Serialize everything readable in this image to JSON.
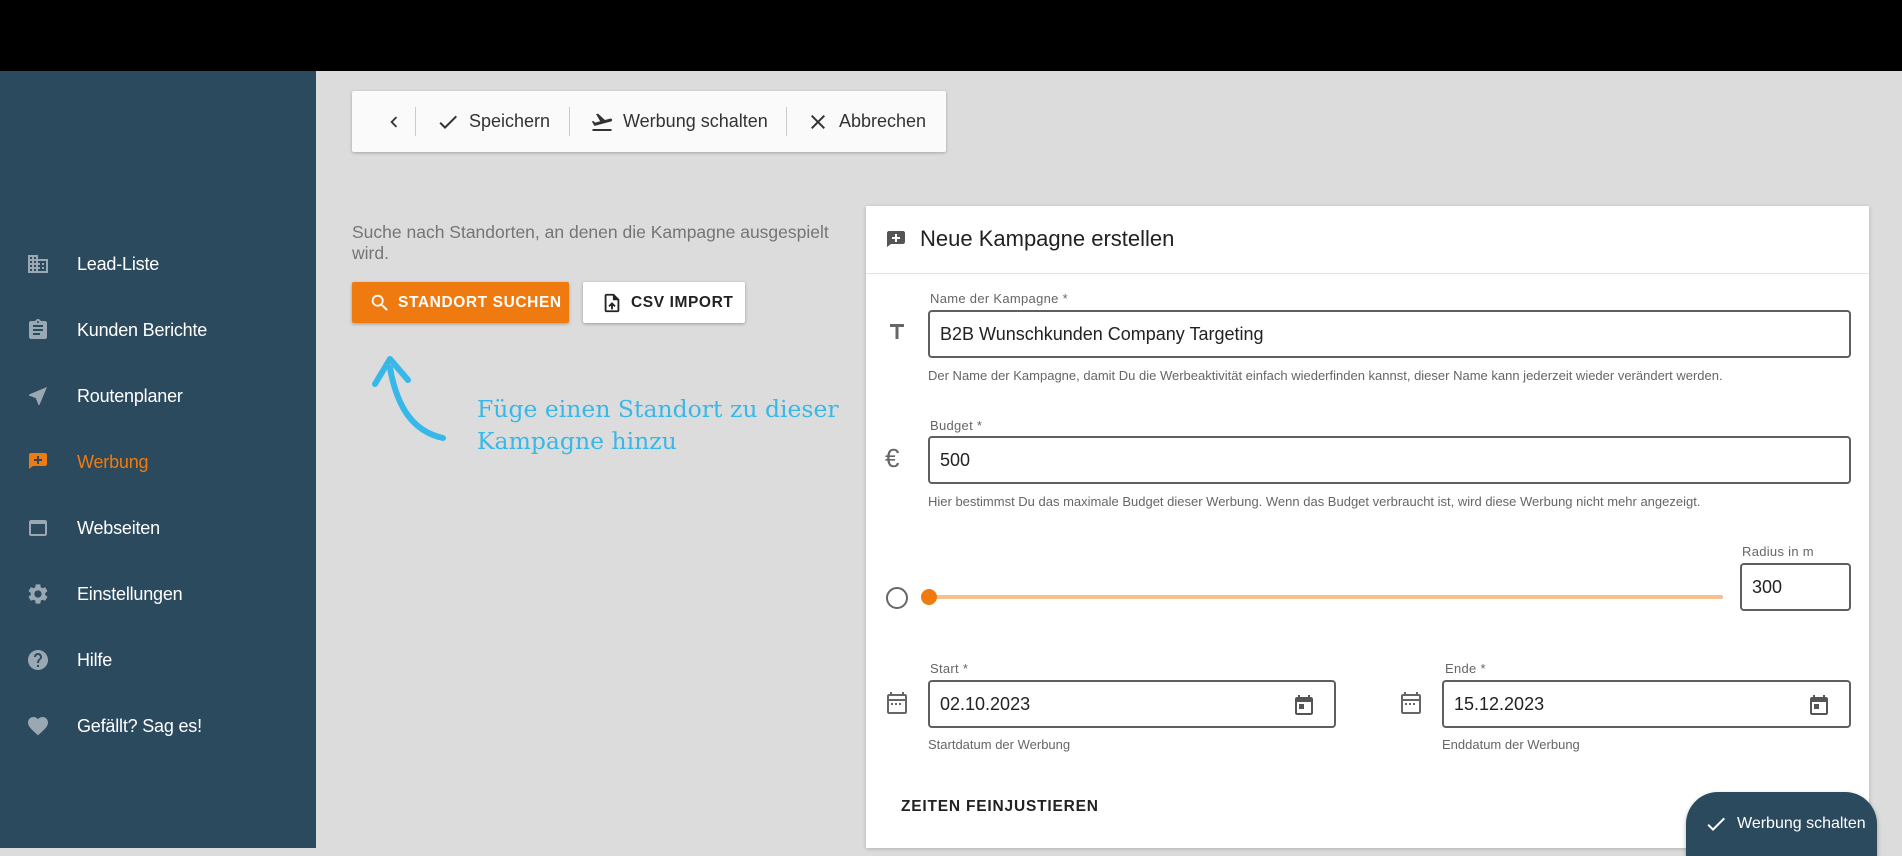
{
  "sidebar": {
    "items": [
      {
        "label": "Lead-Liste",
        "icon": "building-icon",
        "active": false
      },
      {
        "label": "Kunden Berichte",
        "icon": "clipboard-icon",
        "active": false
      },
      {
        "label": "Routenplaner",
        "icon": "navigation-icon",
        "active": false
      },
      {
        "label": "Werbung",
        "icon": "ad-icon",
        "active": true
      },
      {
        "label": "Webseiten",
        "icon": "browser-window-icon",
        "active": false
      },
      {
        "label": "Einstellungen",
        "icon": "gear-icon",
        "active": false
      },
      {
        "label": "Hilfe",
        "icon": "help-icon",
        "active": false
      },
      {
        "label": "Gefällt? Sag es!",
        "icon": "heart-icon",
        "active": false
      }
    ]
  },
  "toolbar": {
    "save_label": "Speichern",
    "publish_label": "Werbung schalten",
    "cancel_label": "Abbrechen"
  },
  "location": {
    "hint": "Suche nach Standorten, an denen die Kampagne ausgespielt wird.",
    "search_button": "STANDORT SUCHEN",
    "csv_button": "CSV IMPORT",
    "annotation": "Füge einen Standort zu dieser Kampagne hinzu"
  },
  "card": {
    "title": "Neue Kampagne erstellen",
    "name": {
      "label": "Name der Kampagne *",
      "value": "B2B Wunschkunden Company Targeting",
      "help": "Der Name der Kampagne, damit Du die Werbeaktivität einfach wiederfinden kannst, dieser Name kann jederzeit wieder verändert werden."
    },
    "budget": {
      "label": "Budget *",
      "value": "500",
      "help": "Hier bestimmst Du das maximale Budget dieser Werbung. Wenn das Budget verbraucht ist, wird diese Werbung nicht mehr angezeigt."
    },
    "radius": {
      "label": "Radius in m",
      "value": "300",
      "slider_fraction": 0.0
    },
    "start": {
      "label": "Start *",
      "value": "02.10.2023",
      "help": "Startdatum der Werbung"
    },
    "end": {
      "label": "Ende *",
      "value": "15.12.2023",
      "help": "Enddatum der Werbung"
    },
    "fine_tune_label": "ZEITEN FEINJUSTIEREN"
  },
  "fab": {
    "label": "Werbung schalten"
  },
  "colors": {
    "accent": "#ef7b10",
    "sidebar": "#2b4a5e",
    "annotation": "#38b8e8"
  }
}
